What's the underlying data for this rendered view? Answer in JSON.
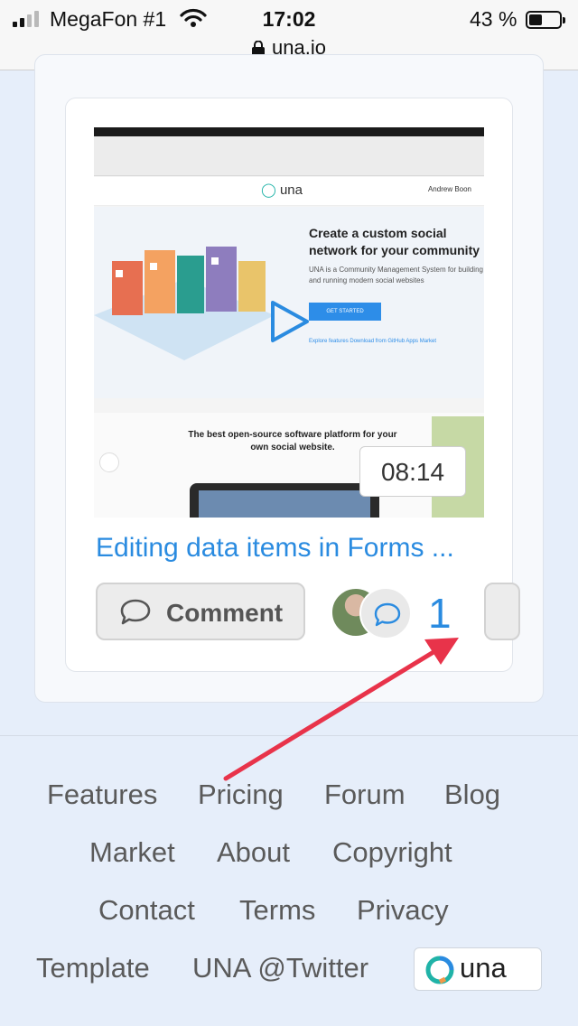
{
  "status_bar": {
    "carrier": "MegaFon #1",
    "time": "17:02",
    "battery": "43 %"
  },
  "url_bar": {
    "domain": "una.io"
  },
  "video_card": {
    "thumbnail": {
      "site_logo": "una",
      "user": "Andrew Boon",
      "hero_title": "Create a custom social network for your community",
      "hero_subtitle": "UNA is a Community Management System for building and running modern social websites",
      "cta": "GET STARTED",
      "links": "Explore features   Download from GitHub   Apps Market",
      "section2_text": "The best open-source software platform for your own social website."
    },
    "duration": "08:14",
    "title": "Editing data items in Forms ...",
    "comment_button_label": "Comment",
    "comment_count": "1"
  },
  "footer": {
    "links": [
      "Features",
      "Pricing",
      "Forum",
      "Blog",
      "Market",
      "About",
      "Copyright",
      "Contact",
      "Terms",
      "Privacy",
      "Template",
      "UNA @Twitter"
    ],
    "logo_text": "una"
  },
  "icons": [
    "signal-icon",
    "wifi-icon",
    "battery-icon",
    "lock-icon",
    "play-icon",
    "comment-icon",
    "chat-bubble-icon",
    "annotation-arrow"
  ],
  "colors": {
    "link": "#2a8be0",
    "annotation_arrow": "#e8334a",
    "una_teal": "#20b3a8"
  }
}
